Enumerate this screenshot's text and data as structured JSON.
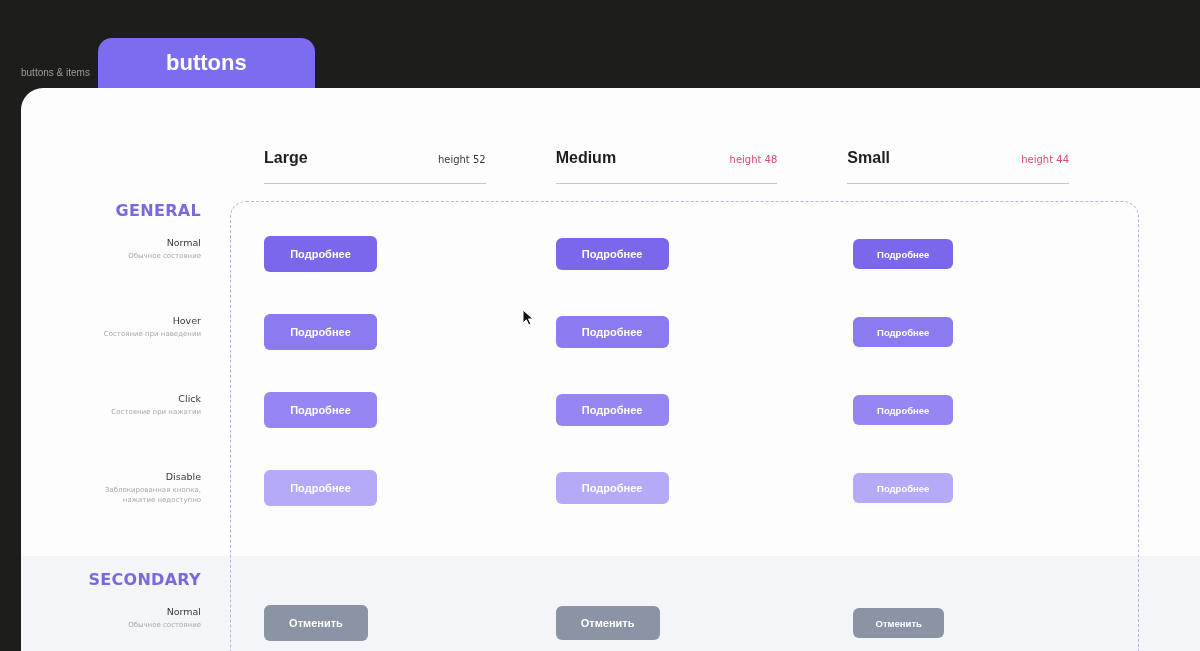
{
  "breadcrumb": "buttons & items",
  "page_tab": "buttons",
  "columns": [
    {
      "label": "Large",
      "kind": "large",
      "note": "height 52",
      "color": "#3a3a3a"
    },
    {
      "label": "Medium",
      "kind": "medium",
      "note": "height 48",
      "color": "#d9487b"
    },
    {
      "label": "Small",
      "kind": "small",
      "note": "height 44",
      "color": "#d9487b"
    }
  ],
  "sections": [
    {
      "title": "GENERAL",
      "kind": "primary",
      "rows": [
        {
          "kind": "normal",
          "state": "Normal",
          "description": "Обычное состояние",
          "buttons": [
            "Подробнее",
            "Подробнее",
            "Подробнее"
          ]
        },
        {
          "kind": "hover",
          "state": "Hover",
          "description": "Состояние при наведении",
          "buttons": [
            "Подробнее",
            "Подробнее",
            "Подробнее"
          ]
        },
        {
          "kind": "click",
          "state": "Click",
          "description": "Состояние при нажатии",
          "buttons": [
            "Подробнее",
            "Подробнее",
            "Подробнее"
          ]
        },
        {
          "kind": "disabled",
          "state": "Disable",
          "description": "Заблокированная кнопка, нажатие недоступно",
          "buttons": [
            "Подробнее",
            "Подробнее",
            "Подробнее"
          ]
        }
      ]
    },
    {
      "title": "SECONDARY",
      "kind": "secondary",
      "rows": [
        {
          "kind": "normal",
          "state": "Normal",
          "description": "Обычное состояние",
          "buttons": [
            "Отменить",
            "Отменить",
            "Отменить"
          ]
        }
      ]
    }
  ]
}
